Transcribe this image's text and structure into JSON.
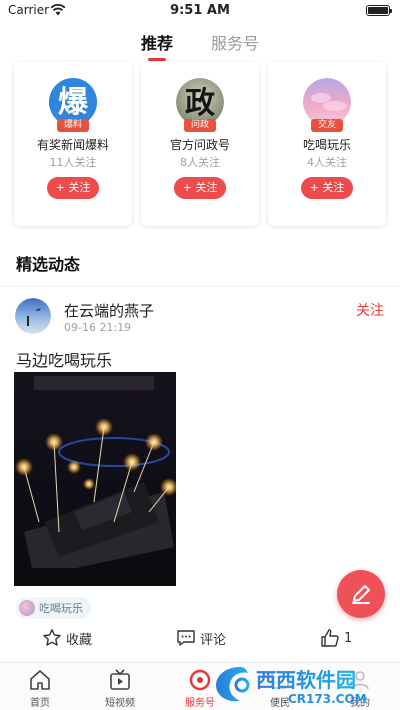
{
  "status_bar": {
    "carrier": "Carrier",
    "time": "9:51 AM"
  },
  "top_tabs": [
    {
      "label": "推荐",
      "active": true
    },
    {
      "label": "服务号",
      "active": false
    }
  ],
  "accounts": [
    {
      "name": "有奖新闻爆料",
      "tag": "爆料",
      "avatar_char": "爆",
      "followers": "11人关注",
      "follow_label": "+ 关注"
    },
    {
      "name": "官方问政号",
      "tag": "问政",
      "avatar_char": "政",
      "followers": "8人关注",
      "follow_label": "+ 关注"
    },
    {
      "name": "吃喝玩乐",
      "tag": "交友",
      "avatar_char": "",
      "followers": "4人关注",
      "follow_label": "+ 关注"
    }
  ],
  "section_title": "精选动态",
  "post": {
    "author": "在云端的燕子",
    "time": "09-16 21:19",
    "follow_label": "关注",
    "text": "马边吃喝玩乐",
    "channel": "吃喝玩乐",
    "actions": {
      "collect": "收藏",
      "comment": "评论",
      "like_count": "1"
    }
  },
  "bottom_nav": [
    {
      "label": "首页",
      "icon": "home-icon"
    },
    {
      "label": "短视频",
      "icon": "video-icon"
    },
    {
      "label": "服务号",
      "icon": "service-icon",
      "active": true
    },
    {
      "label": "便民",
      "icon": "civic-icon"
    },
    {
      "label": "我的",
      "icon": "profile-icon"
    }
  ],
  "watermark": {
    "brand": "西西软件园",
    "domain": "CR173.COM"
  },
  "colors": {
    "accent": "#e6393a",
    "fab": "#ee5258",
    "tag": "#e7513e"
  }
}
